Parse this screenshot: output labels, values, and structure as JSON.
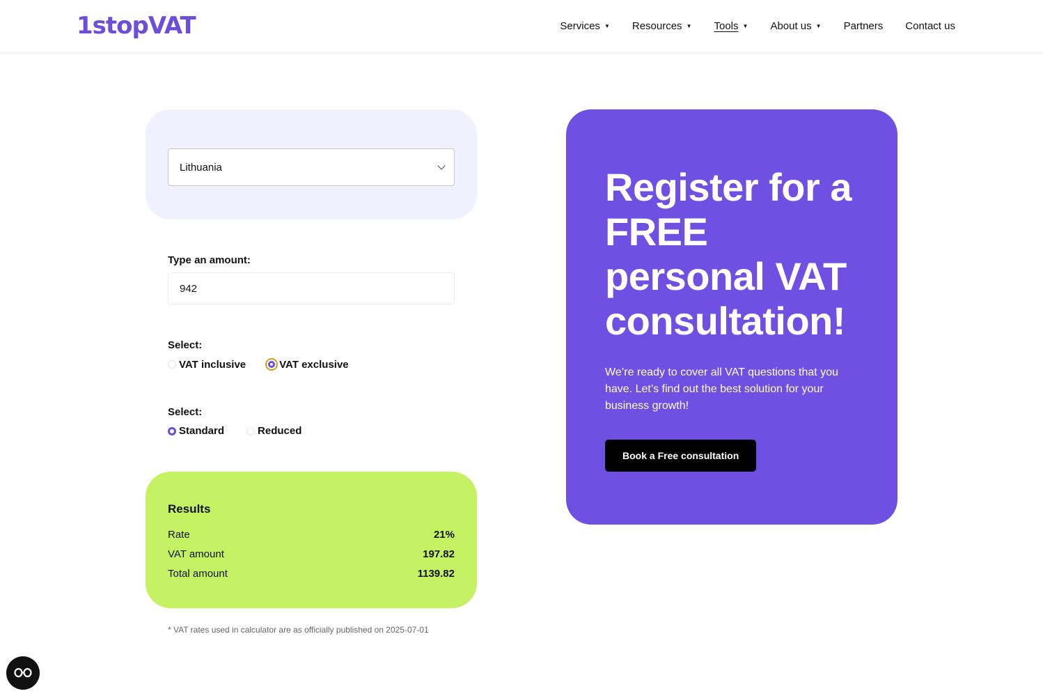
{
  "header": {
    "logo": "1stopVAT",
    "nav": [
      {
        "label": "Services",
        "has_menu": true
      },
      {
        "label": "Resources",
        "has_menu": true
      },
      {
        "label": "Tools",
        "has_menu": true,
        "active": true
      },
      {
        "label": "About us",
        "has_menu": true
      },
      {
        "label": "Partners",
        "has_menu": false
      },
      {
        "label": "Contact us",
        "has_menu": false
      }
    ]
  },
  "calculator": {
    "country": "Lithuania",
    "amount_label": "Type an amount:",
    "amount_value": "942",
    "vat_mode": {
      "label": "Select:",
      "options": [
        "VAT inclusive",
        "VAT exclusive"
      ],
      "selected": "VAT exclusive"
    },
    "rate_type": {
      "label": "Select:",
      "options": [
        "Standard",
        "Reduced"
      ],
      "selected": "Standard"
    },
    "results": {
      "title": "Results",
      "rows": [
        {
          "label": "Rate",
          "value": "21%"
        },
        {
          "label": "VAT amount",
          "value": "197.82"
        },
        {
          "label": "Total amount",
          "value": "1139.82"
        }
      ]
    },
    "footnote": "* VAT rates used in calculator are as officially published on 2025-07-01"
  },
  "promo": {
    "title": "Register for a FREE personal VAT consultation!",
    "body": "We’re ready to cover all VAT questions that you have. Let’s find out the best solution for your business growth!",
    "cta": "Book a Free consultation"
  },
  "colors": {
    "brand": "#6b4fd8",
    "promo_bg": "#7050e3",
    "results_bg": "#c4f263",
    "country_card_bg": "#f1f0ff"
  }
}
